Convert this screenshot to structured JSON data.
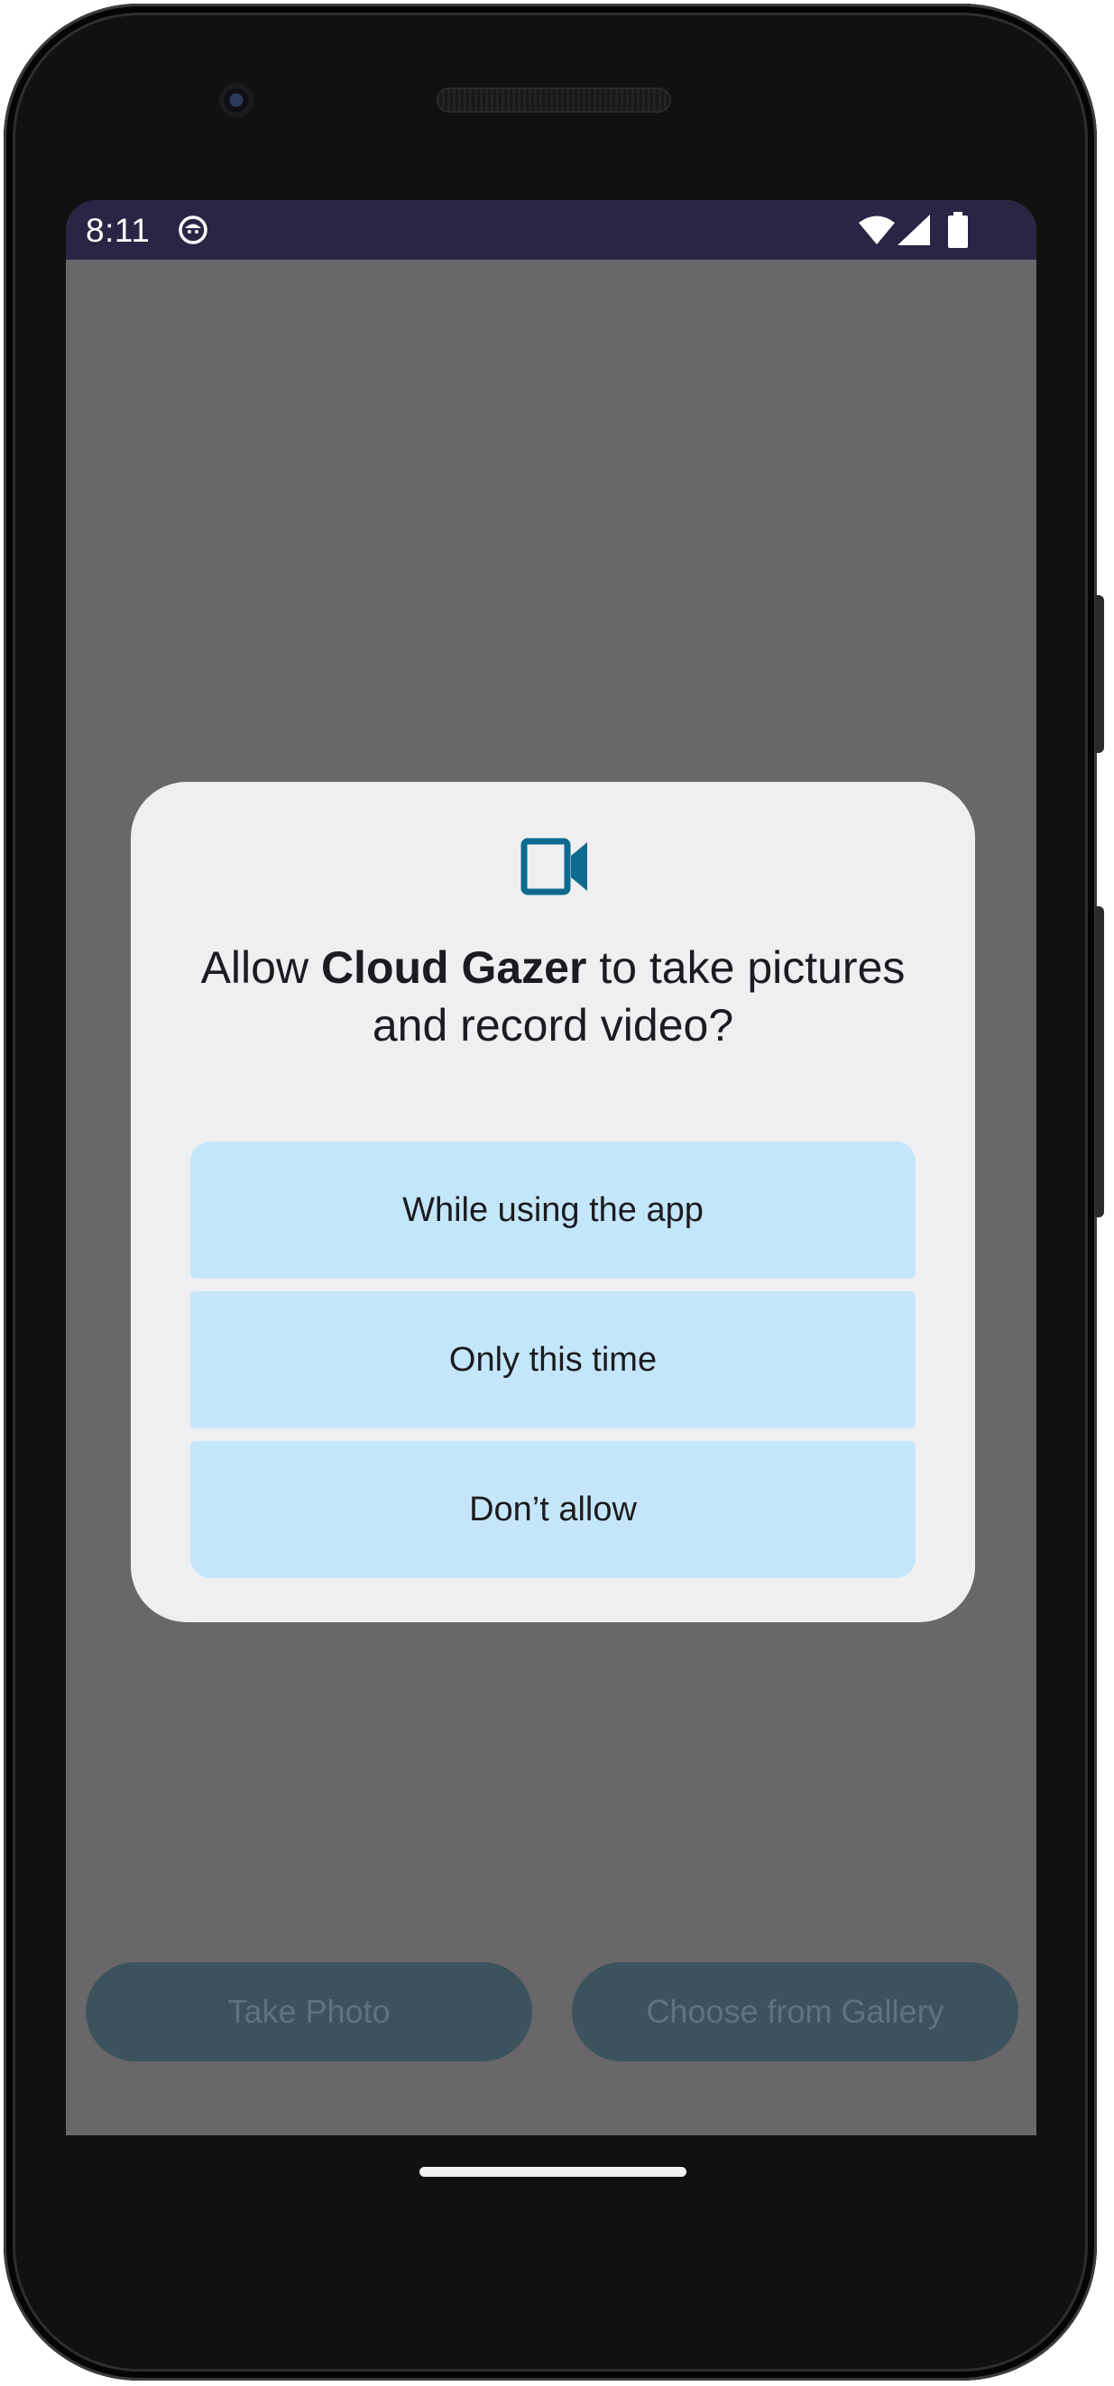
{
  "status_bar": {
    "time": "8:11",
    "notification_icon": "android-face-icon",
    "wifi_icon": "wifi-icon",
    "signal_icon": "cell-signal-icon",
    "battery_icon": "battery-icon"
  },
  "background_buttons": {
    "take_photo": "Take Photo",
    "choose_gallery": "Choose from Gallery"
  },
  "permission_dialog": {
    "icon": "video-camera-icon",
    "title_prefix": "Allow ",
    "app_name": "Cloud Gazer",
    "title_suffix": " to take pictures and record video?",
    "options": [
      "While using the app",
      "Only this time",
      "Don’t allow"
    ],
    "accent_color": "#0e6a8e"
  },
  "colors": {
    "status_bar": "#2b2545",
    "scrim": "#696769",
    "dialog_bg": "#efeff1",
    "option_bg": "#c4e6fb"
  }
}
